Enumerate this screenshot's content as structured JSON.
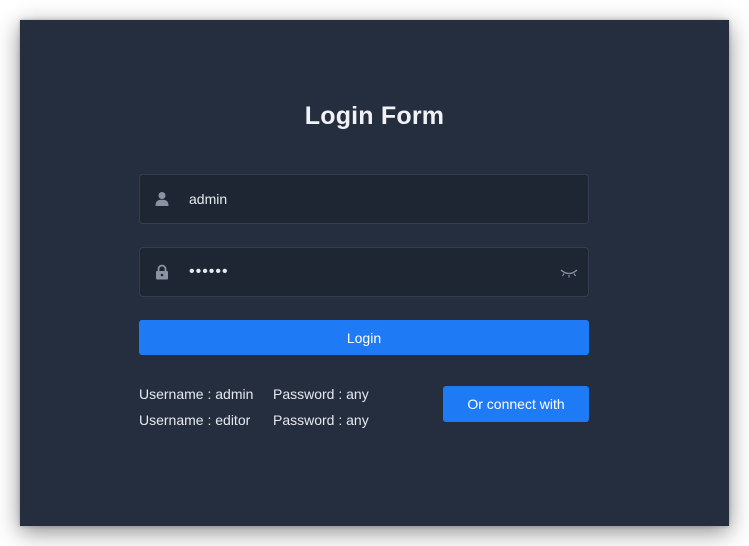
{
  "form": {
    "title": "Login Form",
    "username": {
      "value": "admin",
      "icon": "user-icon"
    },
    "password": {
      "value": "••••••",
      "icon": "lock-icon",
      "toggle_icon": "eye-closed-icon"
    },
    "login_label": "Login",
    "connect_label": "Or connect with"
  },
  "credentials": [
    {
      "username": "Username : admin",
      "password": "Password : any"
    },
    {
      "username": "Username : editor",
      "password": "Password : any"
    }
  ],
  "colors": {
    "background": "#252e3e",
    "field": "#1f2633",
    "accent": "#1e7bf5",
    "icon": "#8a93a3"
  }
}
